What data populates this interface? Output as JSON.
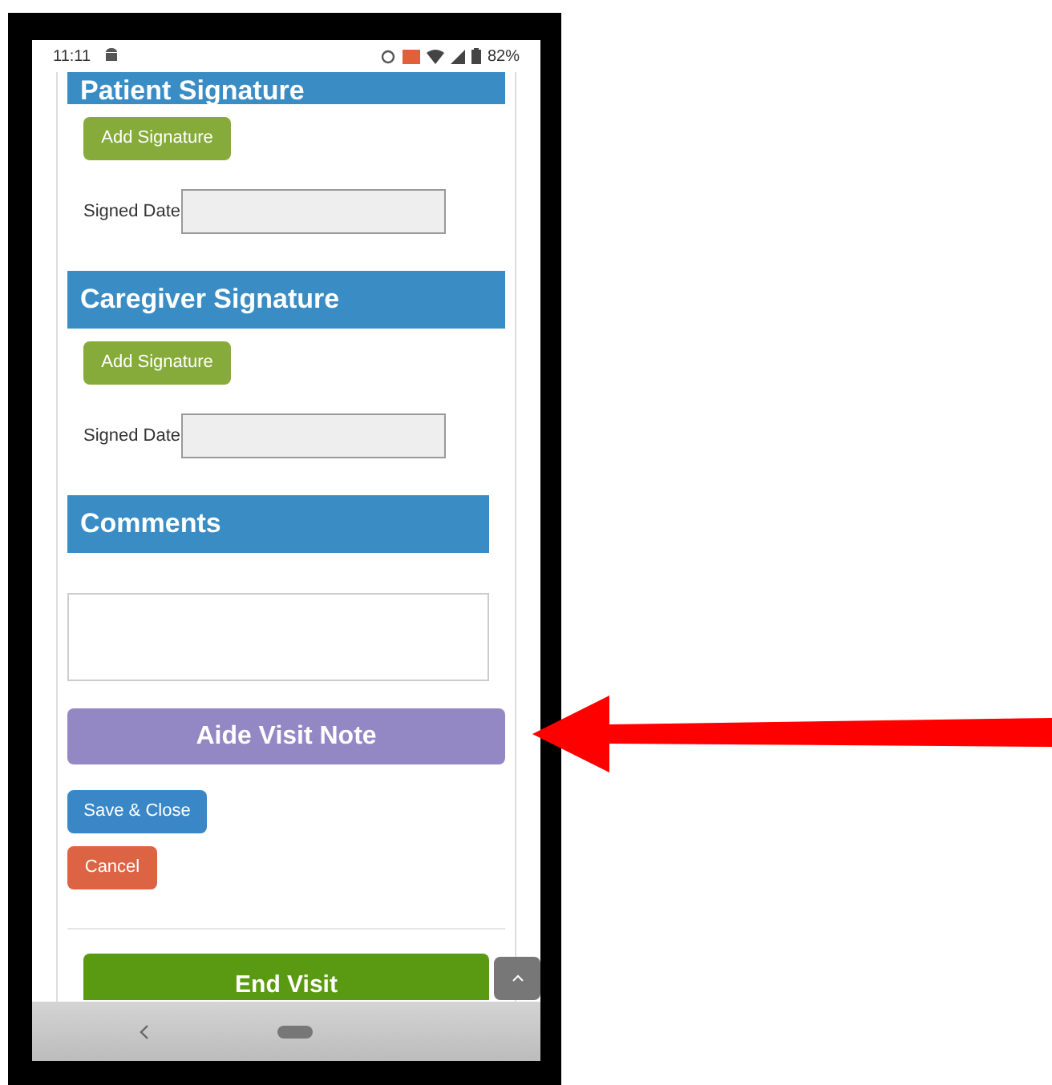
{
  "status_bar": {
    "time": "11:11",
    "battery": "82%"
  },
  "sections": [
    {
      "kind": "signature",
      "title": "Patient Signature",
      "button": "Add Signature",
      "date_label": "Signed Date"
    },
    {
      "kind": "signature",
      "title": "Caregiver Signature",
      "button": "Add Signature",
      "date_label": "Signed Date"
    },
    {
      "kind": "comments",
      "title": "Comments"
    }
  ],
  "note_button": "Aide Visit Note",
  "actions": [
    {
      "kind": "save",
      "label": "Save & Close"
    },
    {
      "kind": "cancel",
      "label": "Cancel"
    }
  ],
  "end_button": "End Visit"
}
